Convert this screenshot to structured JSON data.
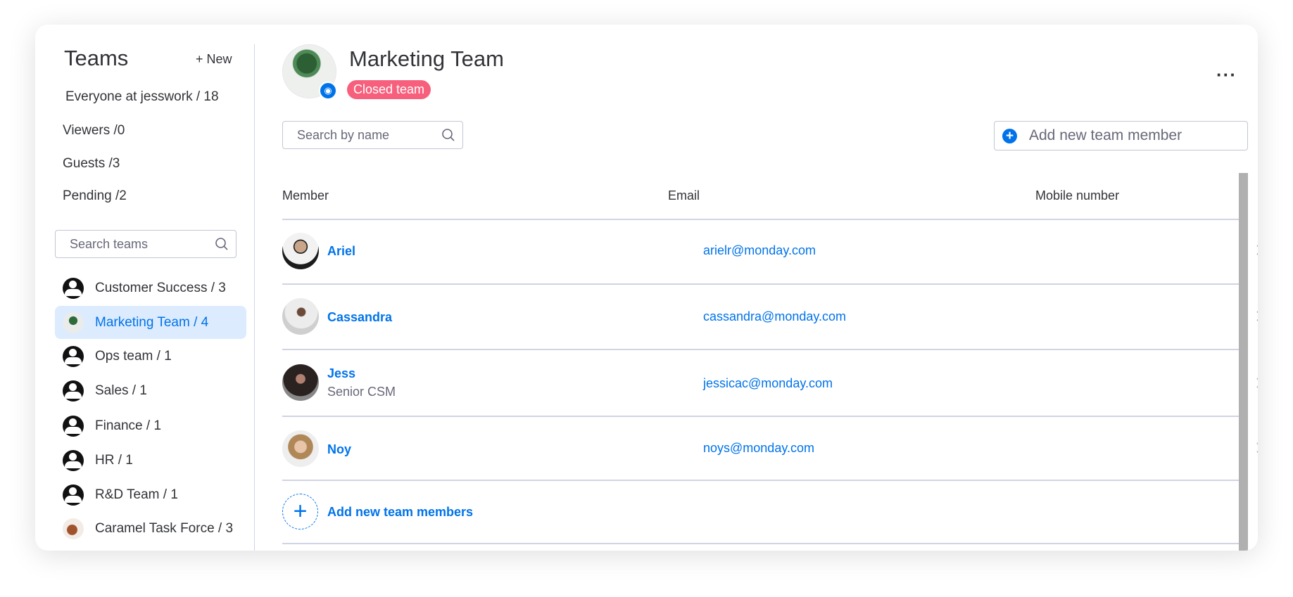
{
  "sidebar": {
    "title": "Teams",
    "new_label": "+ New",
    "groups": [
      {
        "label": "Everyone at jesswork / ",
        "count": "18"
      },
      {
        "label": "Viewers /",
        "count": "0"
      },
      {
        "label": "Guests /",
        "count": "3"
      },
      {
        "label": "Pending /",
        "count": "2"
      }
    ],
    "search_placeholder": "Search teams",
    "teams": [
      {
        "label": "Customer Success / ",
        "count": "3",
        "icon": "people-icon"
      },
      {
        "label": "Marketing Team / ",
        "count": "4",
        "icon": "plant-avatar",
        "active": true
      },
      {
        "label": "Ops team / ",
        "count": "1",
        "icon": "people-icon"
      },
      {
        "label": "Sales / ",
        "count": "1",
        "icon": "people-icon"
      },
      {
        "label": "Finance / ",
        "count": "1",
        "icon": "people-icon"
      },
      {
        "label": "HR / ",
        "count": "1",
        "icon": "people-icon"
      },
      {
        "label": "R&D Team / ",
        "count": "1",
        "icon": "people-icon"
      },
      {
        "label": "Caramel Task Force / ",
        "count": "3",
        "icon": "caramel-avatar"
      }
    ]
  },
  "main": {
    "title": "Marketing Team",
    "badge": "Closed team",
    "badge_color": "#f6607d",
    "menu_icon": "more-dots-icon",
    "search_placeholder": "Search by name",
    "add_member_placeholder": "Add new team member",
    "columns": [
      "Member",
      "Email",
      "Mobile number"
    ],
    "members": [
      {
        "name": "Ariel",
        "title": "",
        "email": "arielr@monday.com",
        "mobile": ""
      },
      {
        "name": "Cassandra",
        "title": "",
        "email": "cassandra@monday.com",
        "mobile": ""
      },
      {
        "name": "Jess",
        "title": "Senior CSM",
        "email": "jessicac@monday.com",
        "mobile": ""
      },
      {
        "name": "Noy",
        "title": "",
        "email": "noys@monday.com",
        "mobile": ""
      }
    ],
    "add_members_label": "Add new team members"
  },
  "colors": {
    "accent": "#0073ea",
    "text": "#323338",
    "muted": "#676879",
    "active_bg": "#dcebfe"
  }
}
